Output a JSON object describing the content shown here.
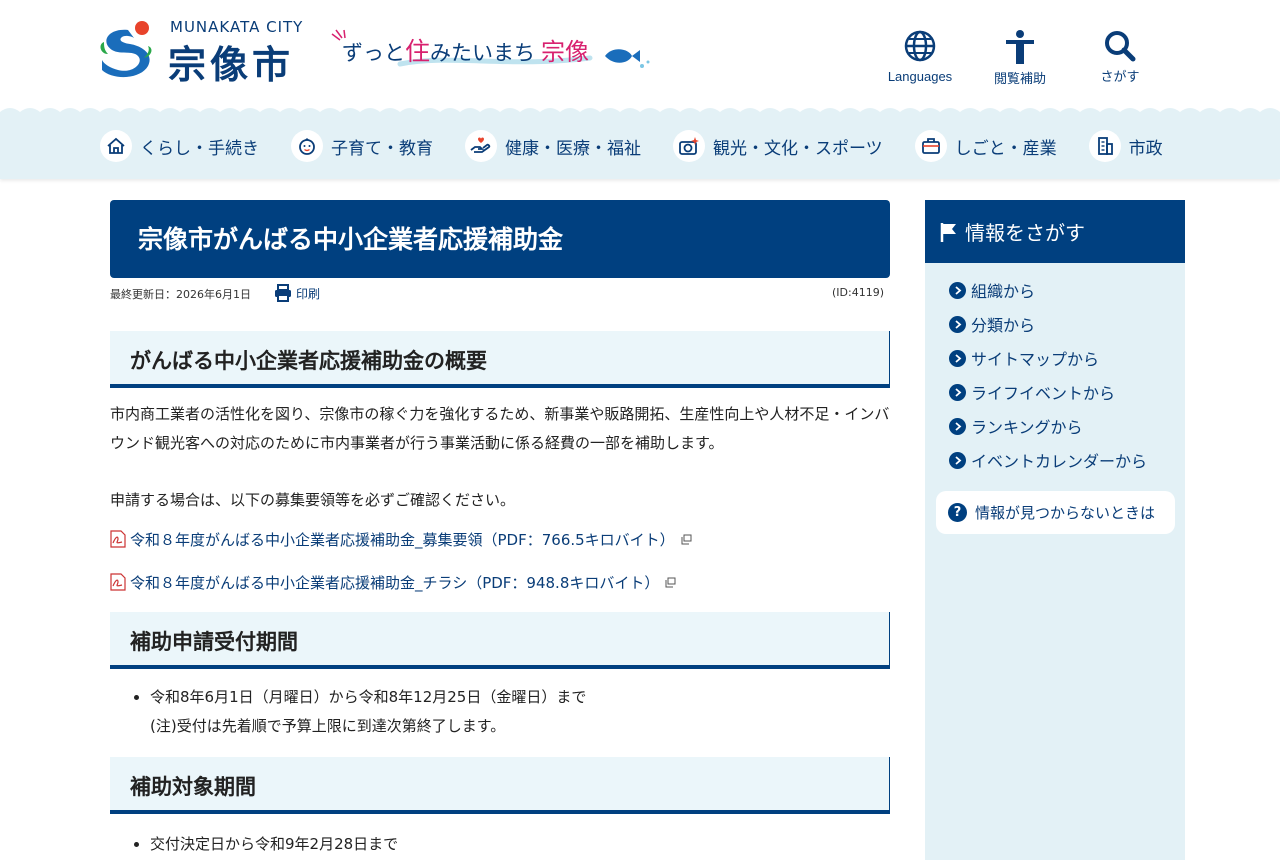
{
  "header": {
    "logo_en": "MUNAKATA CITY",
    "logo_jp": "宗像市",
    "catch_a": "ずっと",
    "catch_b": "住",
    "catch_c": "みたいまち",
    "catch_d": "宗像",
    "tools": [
      {
        "label": "Languages",
        "icon": "globe-icon"
      },
      {
        "label": "閲覧補助",
        "icon": "accessibility-icon"
      },
      {
        "label": "さがす",
        "icon": "search-icon"
      }
    ]
  },
  "nav": {
    "items": [
      {
        "label": "くらし・手続き",
        "icon": "house-icon"
      },
      {
        "label": "子育て・教育",
        "icon": "baby-icon"
      },
      {
        "label": "健康・医療・福祉",
        "icon": "care-hand-icon"
      },
      {
        "label": "観光・文化・スポーツ",
        "icon": "camera-icon"
      },
      {
        "label": "しごと・産業",
        "icon": "briefcase-icon"
      },
      {
        "label": "市政",
        "icon": "city-hall-icon"
      }
    ]
  },
  "main": {
    "title": "宗像市がんばる中小企業者応援補助金",
    "updated": "最終更新日：2026年6月1日",
    "print_label": "印刷",
    "page_id": "(ID:4119)",
    "sections": {
      "overview_heading": "がんばる中小企業者応援補助金の概要",
      "overview_text": "市内商工業者の活性化を図り、宗像市の稼ぐ力を強化するため、新事業や販路開拓、生産性向上や人材不足・インバウンド観光客への対応のために市内事業者が行う事業活動に係る経費の一部を補助します。",
      "confirm_text": "申請する場合は、以下の募集要領等を必ずご確認ください。",
      "pdf_links": [
        "令和８年度がんばる中小企業者応援補助金_募集要領（PDF：766.5キロバイト）",
        "令和８年度がんばる中小企業者応援補助金_チラシ（PDF：948.8キロバイト）"
      ],
      "period_heading": "補助申請受付期間",
      "period_item": "令和8年6月1日（月曜日）から令和8年12月25日（金曜日）まで",
      "period_note": "(注)受付は先着順で予算上限に到達次第終了します。",
      "target_heading": "補助対象期間",
      "target_item": "交付決定日から令和9年2月28日まで"
    }
  },
  "sidebar": {
    "heading": "情報をさがす",
    "items": [
      "組織から",
      "分類から",
      "サイトマップから",
      "ライフイベントから",
      "ランキングから",
      "イベントカレンダーから"
    ],
    "not_found": "情報が見つからないときは"
  },
  "colors": {
    "primary": "#004080",
    "accent_pink": "#d8216f",
    "nav_bg": "#e3f1f6",
    "heading_bg": "#ebf6fa"
  }
}
